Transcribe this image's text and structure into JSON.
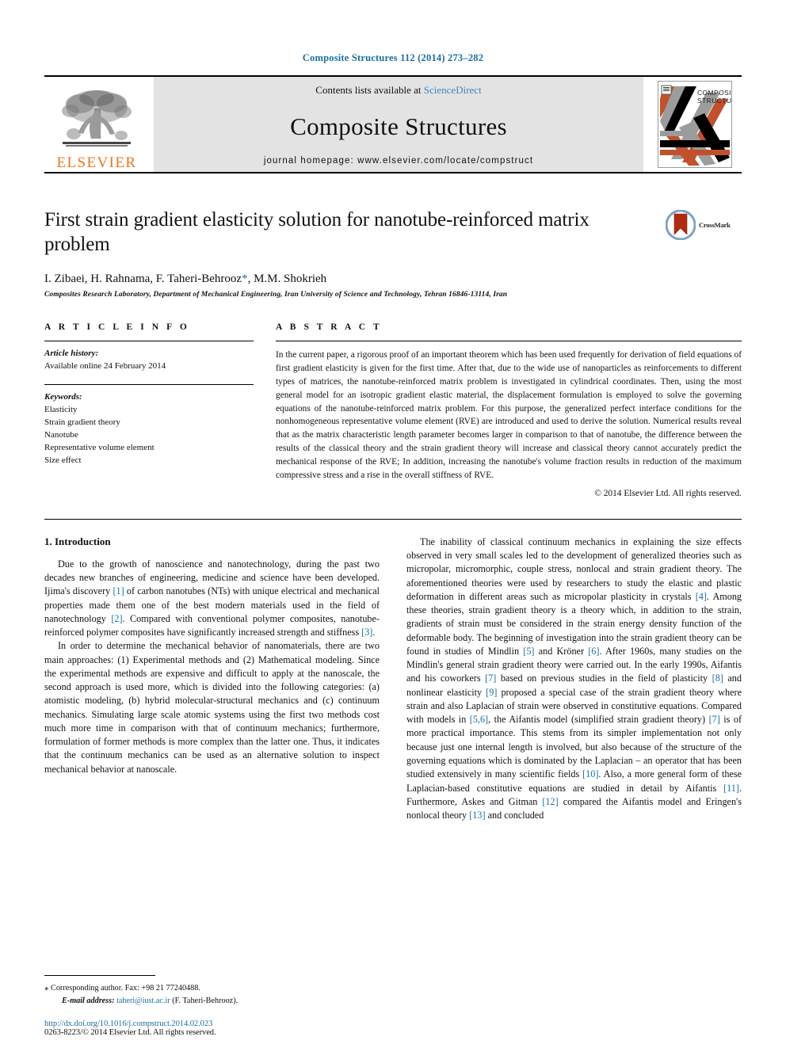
{
  "running_head": "Composite Structures 112 (2014) 273–282",
  "masthead": {
    "publisher_name": "ELSEVIER",
    "contents_prefix": "Contents lists available at ",
    "contents_link": "ScienceDirect",
    "journal_title": "Composite Structures",
    "homepage_line": "journal homepage: www.elsevier.com/locate/compstruct",
    "cover_title_line1": "COMPOSITE",
    "cover_title_line2": "STRUCTURES"
  },
  "article": {
    "title": "First strain gradient elasticity solution for nanotube-reinforced matrix problem",
    "authors_part1": "I. Zibaei, H. Rahnama, F. Taheri-Behrooz",
    "authors_star": "*",
    "authors_part2": ", M.M. Shokrieh",
    "affiliation": "Composites Research Laboratory, Department of Mechanical Engineering, Iran University of Science and Technology, Tehran 16846-13114, Iran",
    "crossmark_label": "CrossMark"
  },
  "article_info": {
    "heading": "A R T I C L E    I N F O",
    "history_label": "Article history:",
    "history_value": "Available online 24 February 2014",
    "keywords_label": "Keywords:",
    "keywords": [
      "Elasticity",
      "Strain gradient theory",
      "Nanotube",
      "Representative volume element",
      "Size effect"
    ]
  },
  "abstract": {
    "heading": "A B S T R A C T",
    "text": "In the current paper, a rigorous proof of an important theorem which has been used frequently for derivation of field equations of first gradient elasticity is given for the first time. After that, due to the wide use of nanoparticles as reinforcements to different types of matrices, the nanotube-reinforced matrix problem is investigated in cylindrical coordinates. Then, using the most general model for an isotropic gradient elastic material, the displacement formulation is employed to solve the governing equations of the nanotube-reinforced matrix problem. For this purpose, the generalized perfect interface conditions for the nonhomogeneous representative volume element (RVE) are introduced and used to derive the solution. Numerical results reveal that as the matrix characteristic length parameter becomes larger in comparison to that of nanotube, the difference between the results of the classical theory and the strain gradient theory will increase and classical theory cannot accurately predict the mechanical response of the RVE; In addition, increasing the nanotube's volume fraction results in reduction of the maximum compressive stress and a rise in the overall stiffness of RVE.",
    "copyright": "© 2014 Elsevier Ltd. All rights reserved."
  },
  "body": {
    "section_heading": "1. Introduction",
    "left_para_1_a": "Due to the growth of nanoscience and nanotechnology, during the past two decades new branches of engineering, medicine and science have been developed. Ijima's discovery ",
    "left_para_1_r1": "[1]",
    "left_para_1_b": " of carbon nanotubes (NTs) with unique electrical and mechanical properties made them one of the best modern materials used in the field of nanotechnology ",
    "left_para_1_r2": "[2]",
    "left_para_1_c": ". Compared with conventional polymer composites, nanotube-reinforced polymer composites have significantly increased strength and stiffness ",
    "left_para_1_r3": "[3]",
    "left_para_1_d": ".",
    "left_para_2": "In order to determine the mechanical behavior of nanomaterials, there are two main approaches: (1) Experimental methods and (2) Mathematical modeling. Since the experimental methods are expensive and difficult to apply at the nanoscale, the second approach is used more, which is divided into the following categories: (a) atomistic modeling, (b) hybrid molecular-structural mechanics and (c) continuum mechanics. Simulating large scale atomic systems using the first two methods cost much more time in comparison with that of continuum mechanics; furthermore, formulation of former methods is more complex than the latter one. Thus, it indicates that the continuum mechanics can be used as an alternative solution to inspect mechanical behavior at nanoscale.",
    "right_para_a": "The inability of classical continuum mechanics in explaining the size effects observed in very small scales led to the development of generalized theories such as micropolar, micromorphic, couple stress, nonlocal and strain gradient theory. The aforementioned theories were used by researchers to study the elastic and plastic deformation in different areas such as micropolar plasticity in crystals ",
    "right_r4": "[4]",
    "right_para_b": ". Among these theories, strain gradient theory is a theory which, in addition to the strain, gradients of strain must be considered in the strain energy density function of the deformable body. The beginning of investigation into the strain gradient theory can be found in studies of Mindlin ",
    "right_r5": "[5]",
    "right_para_c": " and Kröner ",
    "right_r6": "[6]",
    "right_para_d": ". After 1960s, many studies on the Mindlin's general strain gradient theory were carried out. In the early 1990s, Aifantis and his coworkers ",
    "right_r7": "[7]",
    "right_para_e": " based on previous studies in the field of plasticity ",
    "right_r8": "[8]",
    "right_para_f": " and nonlinear elasticity ",
    "right_r9": "[9]",
    "right_para_g": " proposed a special case of the strain gradient theory where strain and also Laplacian of strain were observed in constitutive equations. Compared with models in ",
    "right_r56": "[5,6]",
    "right_para_h": ", the Aifantis model (simplified strain gradient theory) ",
    "right_r7b": "[7]",
    "right_para_i": " is of more practical importance. This stems from its simpler implementation not only because just one internal length is involved, but also because of the structure of the governing equations which is dominated by the Laplacian – an operator that has been studied extensively in many scientific fields ",
    "right_r10": "[10]",
    "right_para_j": ". Also, a more general form of these Laplacian-based constitutive equations are studied in detail by Aifantis ",
    "right_r11": "[11]",
    "right_para_k": ". Furthermore, Askes and Gitman ",
    "right_r12": "[12]",
    "right_para_l": " compared the Aifantis model and Eringen's nonlocal theory ",
    "right_r13": "[13]",
    "right_para_m": " and concluded"
  },
  "footnote": {
    "corresponding": "Corresponding author. Fax: +98 21 77240488.",
    "email_label": "E-mail address:",
    "email": "taheri@iust.ac.ir",
    "email_suffix": " (F. Taheri-Behrooz)."
  },
  "footer": {
    "doi": "http://dx.doi.org/10.1016/j.compstruct.2014.02.023",
    "issn": "0263-8223/© 2014 Elsevier Ltd. All rights reserved."
  },
  "colors": {
    "link_blue": "#1a6fa3",
    "sciencedirect_blue": "#3a86c8",
    "elsevier_orange": "#E87722",
    "masthead_gray": "#e3e3e3"
  }
}
